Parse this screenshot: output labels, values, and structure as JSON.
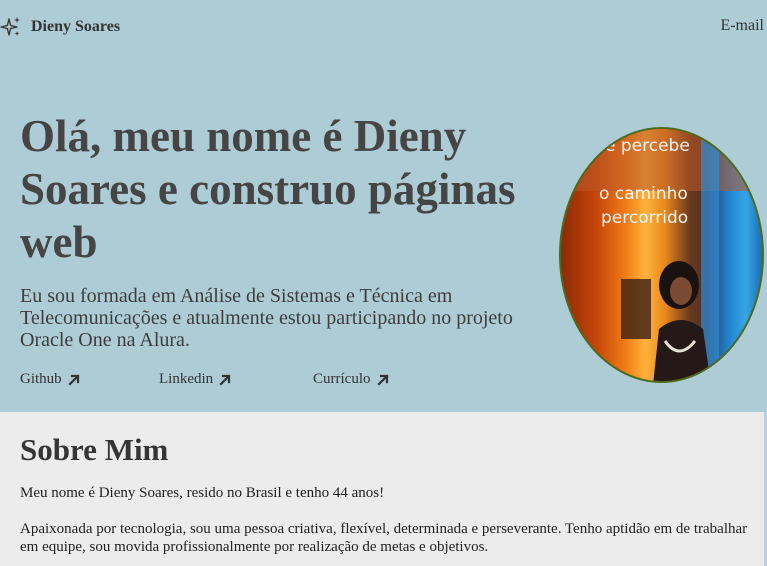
{
  "nav": {
    "brand_icon": "sparkles-icon",
    "brand_name": "Dieny Soares",
    "email_label": "E-mail"
  },
  "hero": {
    "headline": "Olá, meu nome é Dieny Soares e construo páginas web",
    "intro": "Eu sou formada em Análise de Sistemas e Técnica em Telecomunicações e atualmente estou participando no projeto Oracle One na Alura.",
    "links": [
      {
        "label": "Github",
        "icon": "arrow-up-right-icon"
      },
      {
        "label": "Linkedin",
        "icon": "arrow-up-right-icon"
      },
      {
        "label": "Currículo",
        "icon": "arrow-up-right-icon"
      }
    ],
    "photo_caption_lines": [
      "é percebe",
      "o caminho",
      "percorrido"
    ]
  },
  "about": {
    "title": "Sobre Mim",
    "paragraph1": "Meu nome é Dieny Soares, resido no Brasil e tenho 44 anos!",
    "paragraph2": "Apaixonada por tecnologia, sou uma pessoa criativa, flexível, determinada e perseverante. Tenho aptidão em de trabalhar em equipe, sou movida profissionalmente por realização de metas e objetivos."
  },
  "colors": {
    "hero_background": "#adccd6",
    "about_background": "#ececec",
    "text": "#454545"
  }
}
